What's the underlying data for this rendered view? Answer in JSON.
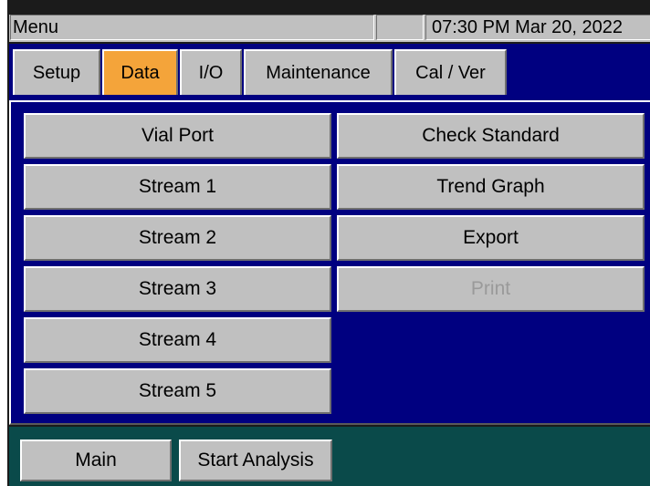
{
  "titlebar": {
    "menu_label": "Menu",
    "blank": "",
    "datetime": "07:30 PM Mar 20, 2022"
  },
  "tabs": [
    {
      "label": "Setup",
      "active": false
    },
    {
      "label": "Data",
      "active": true
    },
    {
      "label": "I/O",
      "active": false
    },
    {
      "label": "Maintenance",
      "active": false
    },
    {
      "label": "Cal / Ver",
      "active": false
    }
  ],
  "data_buttons": {
    "left": [
      "Vial Port",
      "Stream 1",
      "Stream 2",
      "Stream 3",
      "Stream 4",
      "Stream 5"
    ],
    "right": [
      {
        "label": "Check Standard",
        "enabled": true
      },
      {
        "label": "Trend Graph",
        "enabled": true
      },
      {
        "label": "Export",
        "enabled": true
      },
      {
        "label": "Print",
        "enabled": false
      }
    ]
  },
  "bottom": {
    "main_label": "Main",
    "start_analysis_label": "Start Analysis"
  },
  "colors": {
    "panel_blue": "#000080",
    "active_tab": "#f4a43a",
    "bottom_bar": "#0a4a4a",
    "button_gray": "#c0c0c0"
  }
}
